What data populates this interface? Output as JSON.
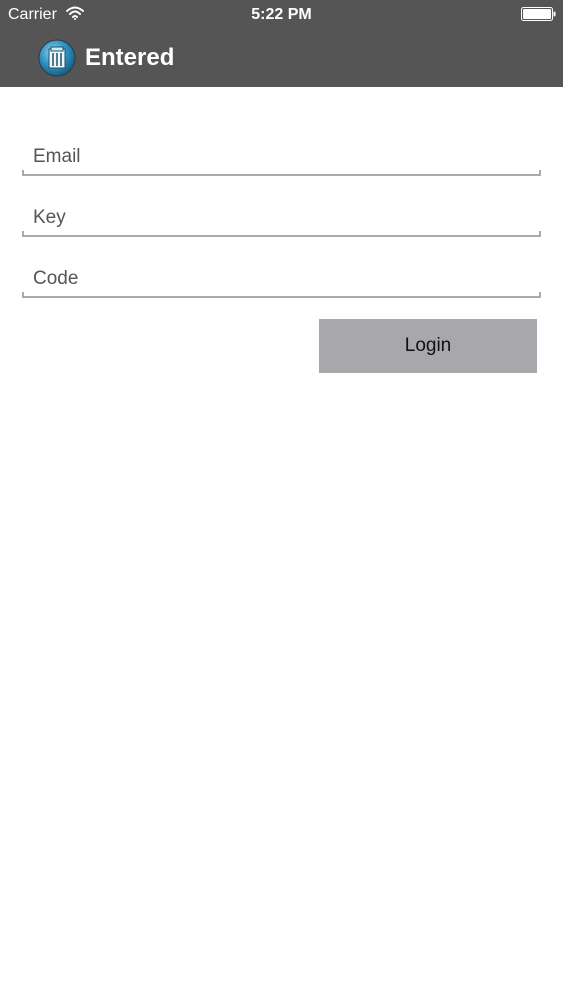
{
  "status_bar": {
    "carrier": "Carrier",
    "time": "5:22 PM",
    "wifi_icon": "wifi-icon",
    "battery_icon": "battery-icon"
  },
  "header": {
    "logo_icon": "app-logo-icon",
    "title": "Entered"
  },
  "form": {
    "email": {
      "placeholder": "Email",
      "value": ""
    },
    "key": {
      "placeholder": "Key",
      "value": ""
    },
    "code": {
      "placeholder": "Code",
      "value": ""
    },
    "login_label": "Login"
  },
  "colors": {
    "header_background": "#555555",
    "button_background": "#a8a7ab",
    "field_underline": "#aaaaaa",
    "page_background": "#ffffff"
  }
}
